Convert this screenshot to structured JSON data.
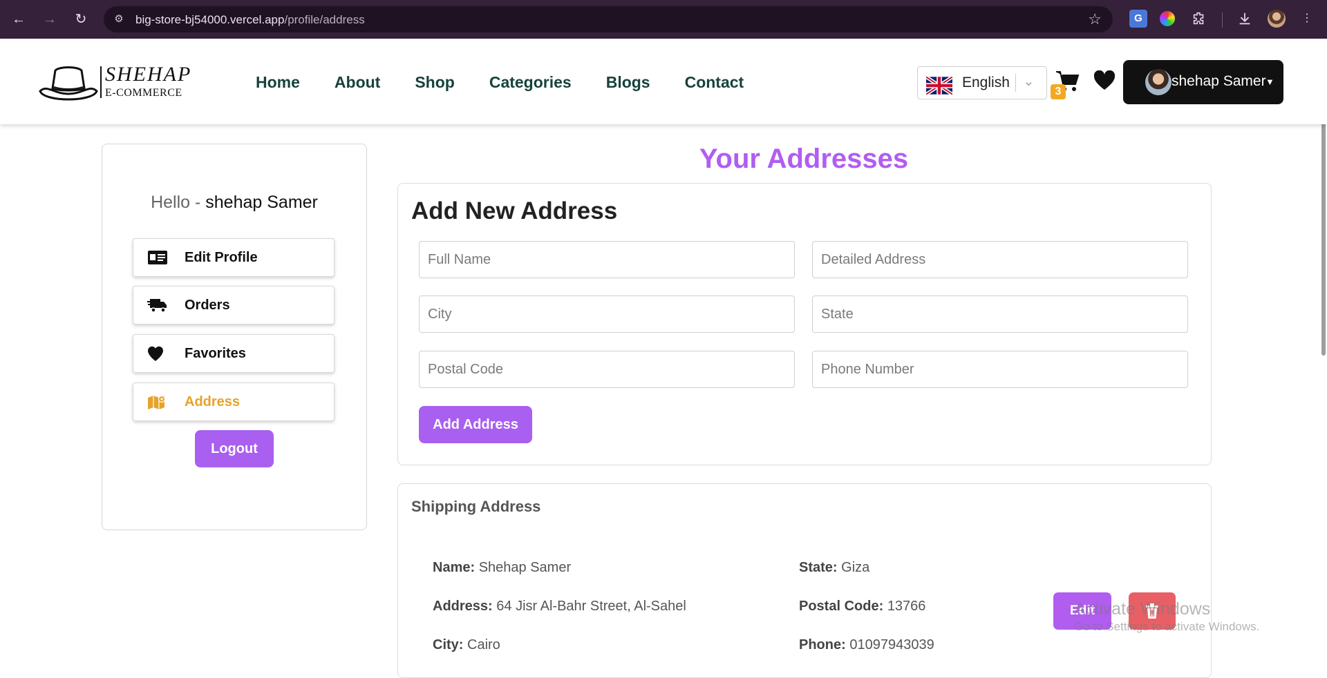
{
  "browser": {
    "url_host": "big-store-bj54000.vercel.app",
    "url_path": "/profile/address",
    "translate_label": "G"
  },
  "header": {
    "logo_name": "SHEHAP",
    "logo_sub": "E-COMMERCE",
    "nav": [
      "Home",
      "About",
      "Shop",
      "Categories",
      "Blogs",
      "Contact"
    ],
    "language": "English",
    "cart_count": "3",
    "user_name": "shehap Samer"
  },
  "sidebar": {
    "hello_prefix": "Hello - ",
    "user_name": "shehap Samer",
    "items": [
      {
        "label": "Edit Profile",
        "icon": "id-card-icon"
      },
      {
        "label": "Orders",
        "icon": "truck-icon"
      },
      {
        "label": "Favorites",
        "icon": "heart-icon"
      },
      {
        "label": "Address",
        "icon": "map-icon",
        "active": true
      }
    ],
    "logout_label": "Logout"
  },
  "main": {
    "title": "Your Addresses",
    "form": {
      "heading": "Add New Address",
      "full_name_placeholder": "Full Name",
      "detailed_address_placeholder": "Detailed Address",
      "city_placeholder": "City",
      "state_placeholder": "State",
      "postal_code_placeholder": "Postal Code",
      "phone_placeholder": "Phone Number",
      "submit_label": "Add Address"
    },
    "shipping": {
      "heading": "Shipping Address",
      "name_label": "Name:",
      "name": "Shehap Samer",
      "address_label": "Address:",
      "address": "64 Jisr Al-Bahr Street, Al-Sahel",
      "city_label": "City:",
      "city": "Cairo",
      "state_label": "State:",
      "state": "Giza",
      "postal_label": "Postal Code:",
      "postal": "13766",
      "phone_label": "Phone:",
      "phone": "01097943039",
      "edit_label": "Edit"
    }
  },
  "watermark": {
    "title": "Activate Windows",
    "subtitle": "Go to Settings to activate Windows."
  },
  "colors": {
    "accent": "#a95ff0",
    "title": "#b15df0",
    "active_item": "#e4a32b",
    "delete": "#e85f66",
    "nav_text": "#17423c",
    "chrome": "#35213a"
  }
}
